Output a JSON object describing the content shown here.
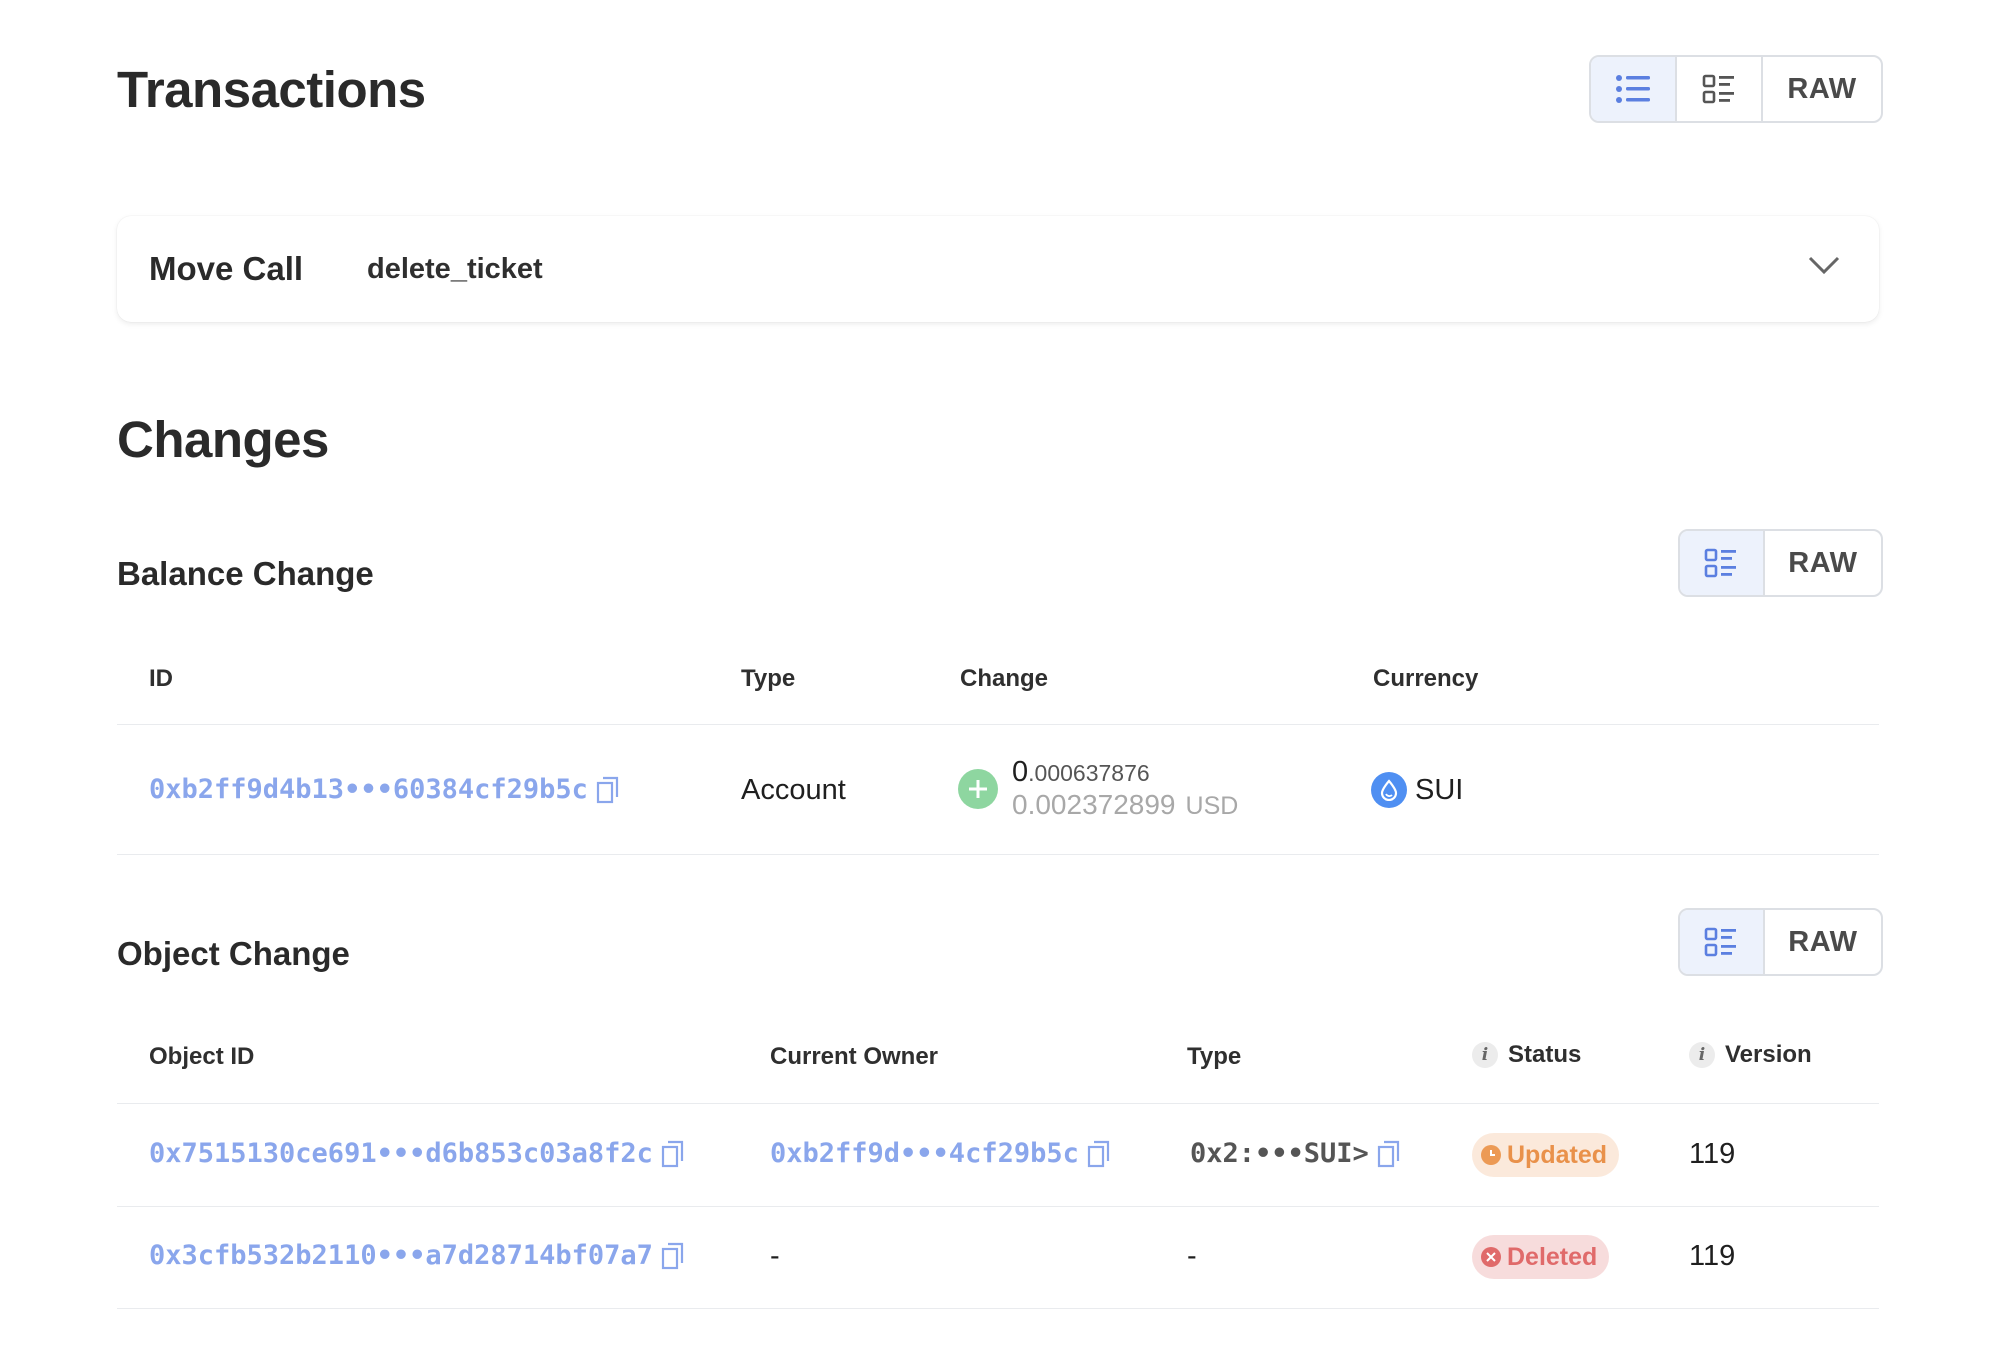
{
  "transactions": {
    "title": "Transactions",
    "view_toggle": {
      "raw_label": "RAW",
      "active": "list-view"
    },
    "move_call": {
      "label": "Move Call",
      "function": "delete_ticket"
    }
  },
  "changes": {
    "title": "Changes",
    "balance_change": {
      "title": "Balance Change",
      "raw_label": "RAW",
      "columns": [
        "ID",
        "Type",
        "Change",
        "Currency"
      ],
      "rows": [
        {
          "id": "0xb2ff9d4b13•••60384cf29b5c",
          "type": "Account",
          "change_whole": "0",
          "change_fraction": ".000637876",
          "usd_value": "0.002372899",
          "usd_label": "USD",
          "currency": "SUI"
        }
      ]
    },
    "object_change": {
      "title": "Object Change",
      "raw_label": "RAW",
      "columns": [
        "Object ID",
        "Current Owner",
        "Type",
        "Status",
        "Version"
      ],
      "rows": [
        {
          "object_id": "0x7515130ce691•••d6b853c03a8f2c",
          "owner": "0xb2ff9d•••4cf29b5c",
          "type": "0x2:•••SUI>",
          "status": "Updated",
          "version": "119"
        },
        {
          "object_id": "0x3cfb532b2110•••a7d28714bf07a7",
          "owner": "-",
          "type": "-",
          "status": "Deleted",
          "version": "119"
        }
      ]
    }
  },
  "colors": {
    "link": "#8aa6ec",
    "updated": "#ec9a55",
    "deleted": "#e06a6a",
    "positive": "#8ed6a0",
    "sui": "#4f8ff2"
  }
}
